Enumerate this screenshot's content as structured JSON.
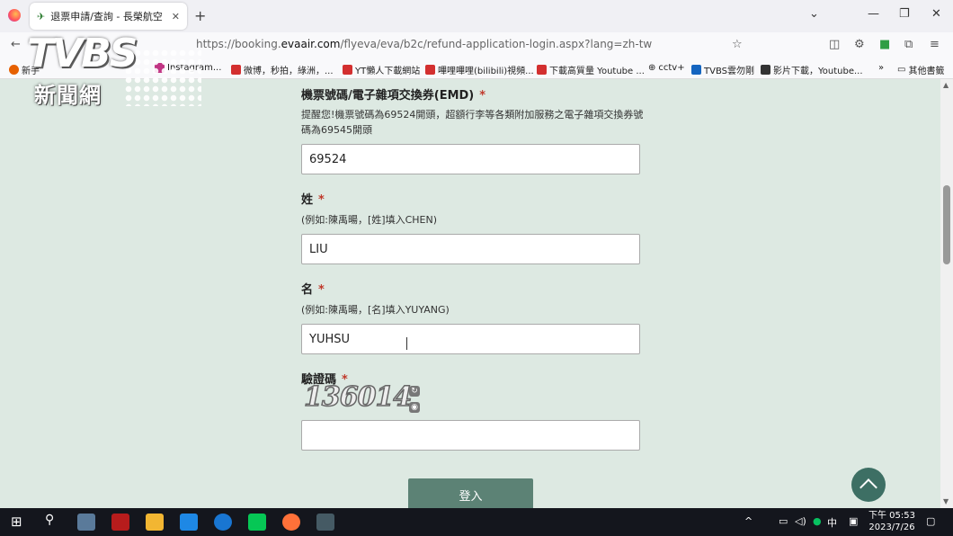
{
  "browser": {
    "tab_title": "退票申請/查詢 - 長榮航空 | 台灣",
    "url_prefix": "https://booking.",
    "url_domain": "evaair.com",
    "url_path": "/flyeva/eva/b2c/refund-application-login.aspx?lang=zh-tw",
    "bookmarks": [
      {
        "label": "新手",
        "icon": "firefox-icon",
        "color": "#e66000"
      },
      {
        "label": "Instagram...",
        "icon": "instagram-icon",
        "color": "#c13584"
      },
      {
        "label": "微博，秒拍，綠洲，...",
        "icon": "download-icon",
        "color": "#d32f2f"
      },
      {
        "label": "YT懶人下載網站",
        "icon": "download-icon",
        "color": "#d32f2f"
      },
      {
        "label": "嗶哩嗶哩(bilibili)視頻...",
        "icon": "download-icon",
        "color": "#d32f2f"
      },
      {
        "label": "下載高質量 Youtube ...",
        "icon": "download-icon",
        "color": "#d32f2f"
      },
      {
        "label": "cctv+",
        "icon": "globe-icon",
        "color": "#666666"
      },
      {
        "label": "TVBS雲勿剛",
        "icon": "tvbs-icon",
        "color": "#1565c0"
      },
      {
        "label": "影片下載，Youtube...",
        "icon": "video-icon",
        "color": "#333333"
      }
    ],
    "other_bookmarks": "其他書籤"
  },
  "watermark": {
    "logo": "TVBS",
    "subtitle": "新聞網"
  },
  "form": {
    "emd": {
      "title": "機票號碼/電子雜項交換券(EMD)",
      "required": "*",
      "hint_line1": "提醒您!機票號碼為69524開頭，超額行李等各類附加服務之電子雜項交換券號",
      "hint_line2": "碼為69545開頭",
      "value": "69524"
    },
    "surname": {
      "title": "姓",
      "required": "*",
      "hint": "(例如:陳禹暘，[姓]填入CHEN)",
      "value": "LIU"
    },
    "given_name": {
      "title": "名",
      "required": "*",
      "hint": "(例如:陳禹暘，[名]填入YUYANG)",
      "value": "YUHSU"
    },
    "captcha": {
      "title": "驗證碼",
      "required": "*",
      "image_text": "136014",
      "value": ""
    },
    "login_button": "登入"
  },
  "taskbar": {
    "ime": "中",
    "time": "下午 05:53",
    "date": "2023/7/26"
  }
}
